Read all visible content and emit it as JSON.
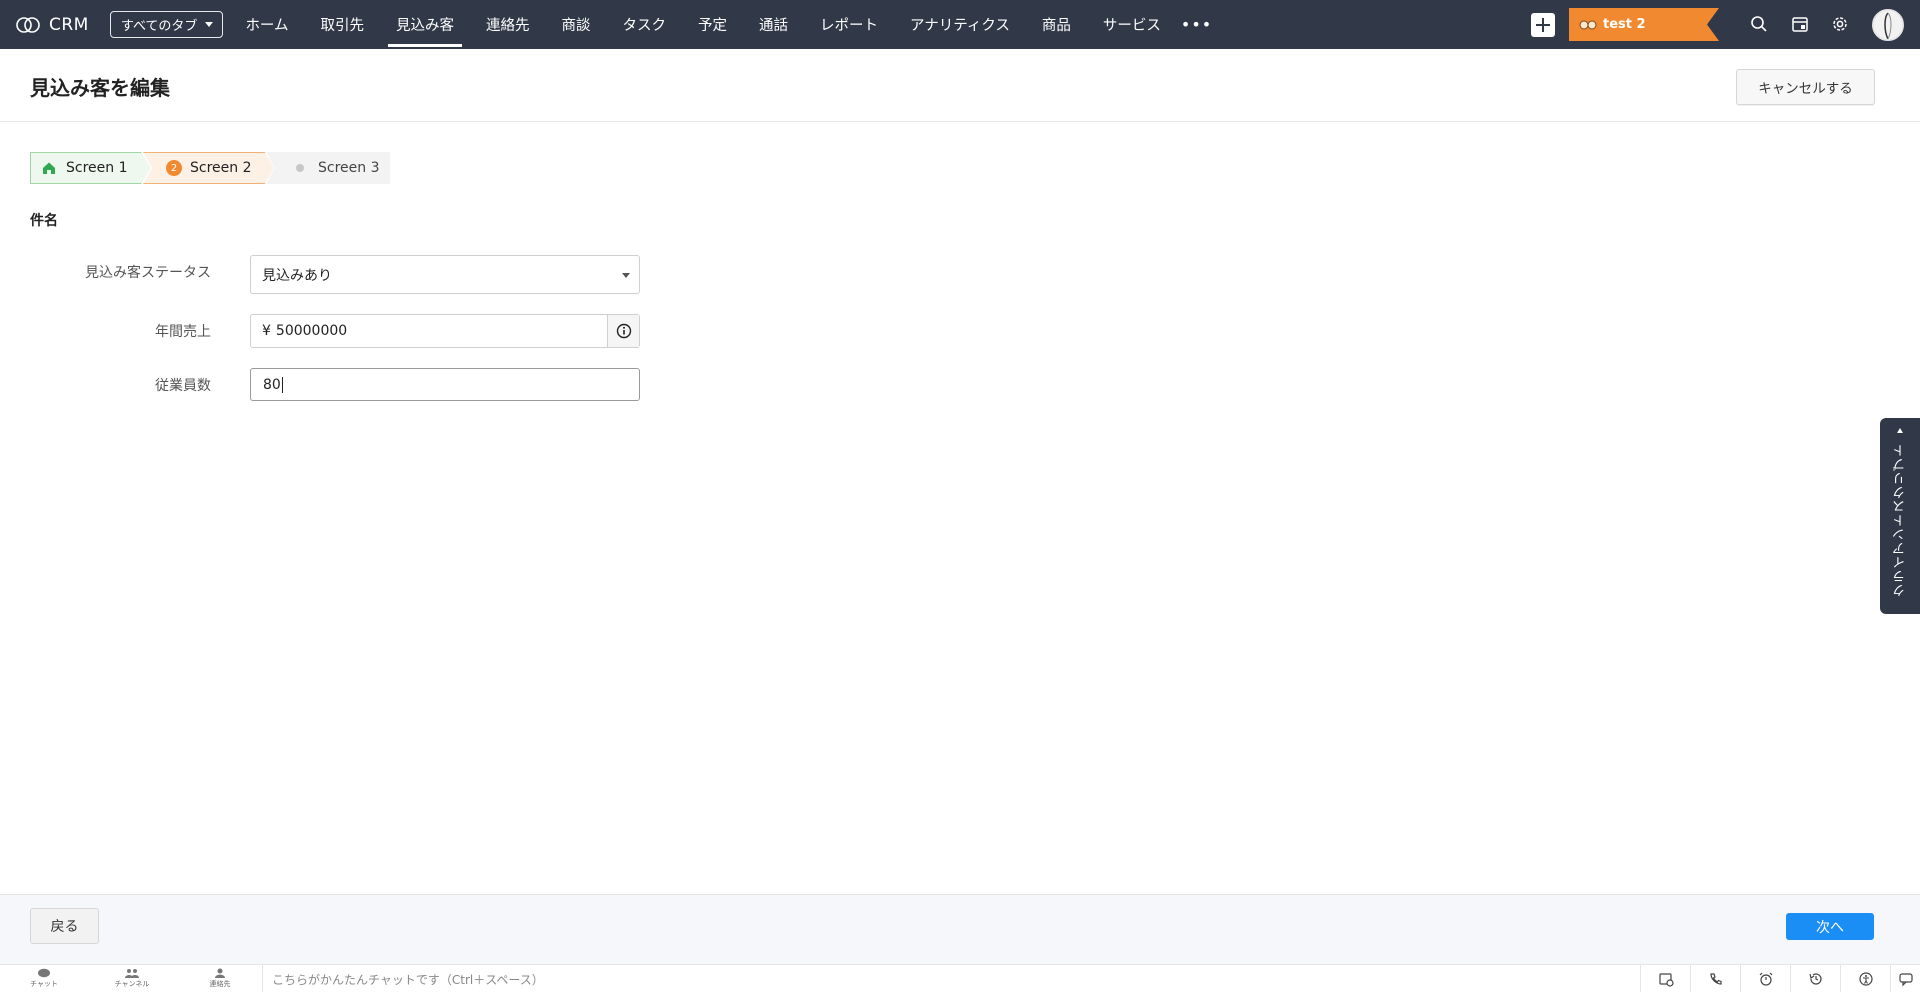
{
  "app": {
    "name": "CRM"
  },
  "nav": {
    "all_tabs_label": "すべてのタブ",
    "tabs": [
      "ホーム",
      "取引先",
      "見込み客",
      "連絡先",
      "商談",
      "タスク",
      "予定",
      "通話",
      "レポート",
      "アナリティクス",
      "商品",
      "サービス"
    ],
    "active_tab": "見込み客",
    "more": "•••",
    "org_name": "test 2",
    "org_color": "#f0892f",
    "bar_color": "#313949"
  },
  "header": {
    "title": "見込み客を編集",
    "cancel_label": "キャンセルする"
  },
  "steps": [
    {
      "label": "Screen 1",
      "state": "completed"
    },
    {
      "label": "Screen 2",
      "number": "2",
      "state": "current"
    },
    {
      "label": "Screen 3",
      "state": "upcoming"
    }
  ],
  "section": {
    "title": "件名"
  },
  "fields": {
    "lead_status": {
      "label": "見込み客ステータス",
      "value": "見込みあり"
    },
    "annual_revenue": {
      "label": "年間売上",
      "currency": "¥",
      "value": "50000000"
    },
    "employees": {
      "label": "従業員数",
      "value": "80"
    }
  },
  "side_panel": {
    "label": "クライアントスクリプト"
  },
  "footer": {
    "back_label": "戻る",
    "next_label": "次へ",
    "next_color": "#1a8ef4"
  },
  "bottom_bar": {
    "items": [
      {
        "label": "チャット",
        "icon": "chat-icon"
      },
      {
        "label": "チャンネル",
        "icon": "channel-icon"
      },
      {
        "label": "連絡先",
        "icon": "contact-icon"
      }
    ],
    "chat_placeholder": "こちらがかんたんチャットです（Ctrl＋スペース）",
    "right_icons": [
      "calendar-activity-icon",
      "phone-icon",
      "alarm-icon",
      "history-icon",
      "accessibility-icon",
      "chat-bubble-icon"
    ]
  }
}
